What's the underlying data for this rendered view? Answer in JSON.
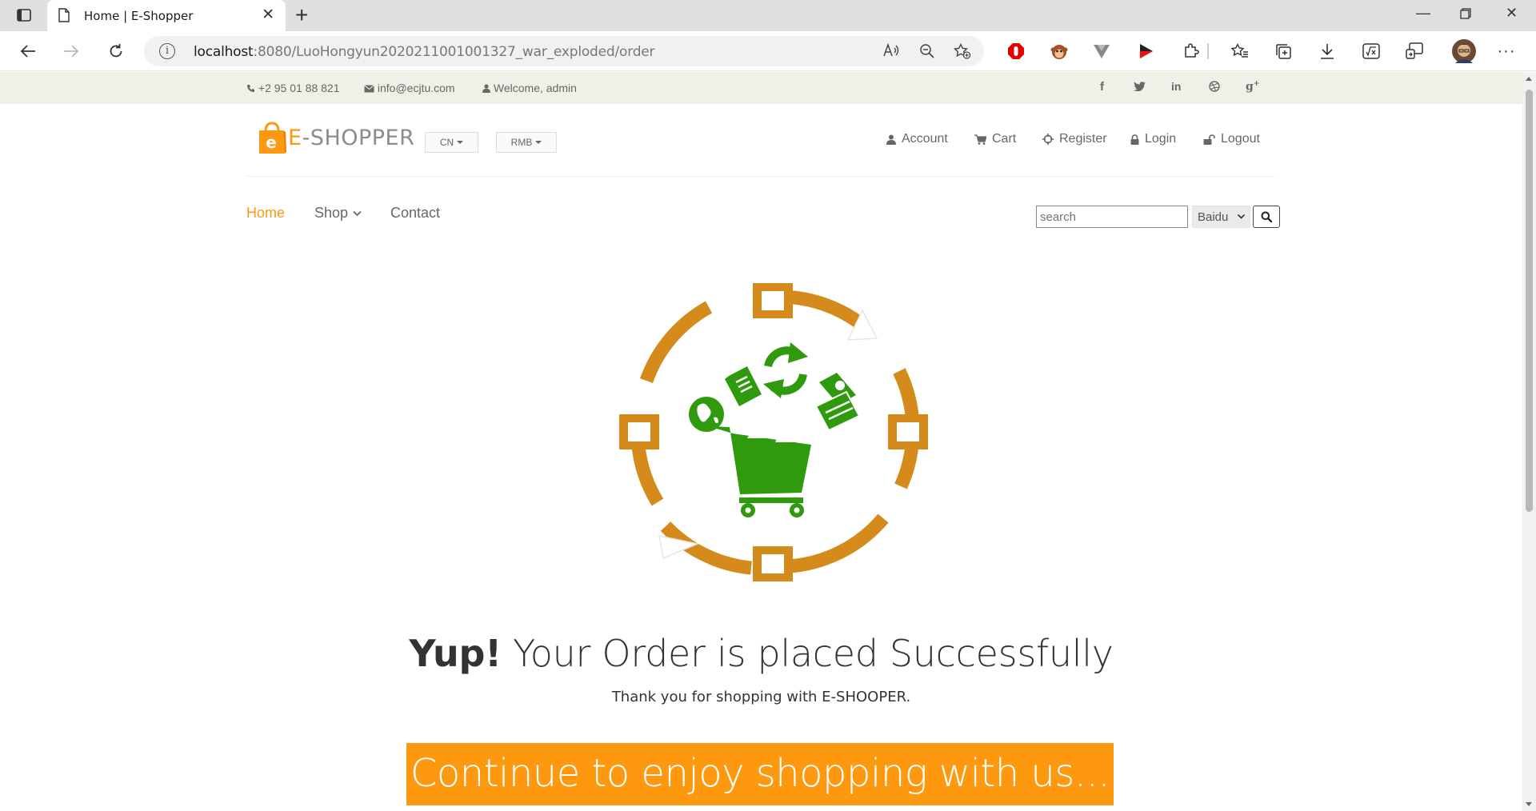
{
  "browser": {
    "tab_title": "Home | E-Shopper",
    "url_host": "localhost",
    "url_rest": ":8080/LuoHongyun2020211001001327_war_exploded/order"
  },
  "topbar": {
    "phone": "+2 95 01 88 821",
    "email": "info@ecjtu.com",
    "welcome": "Welcome, admin",
    "social": [
      "f",
      "t",
      "in",
      "dribbble",
      "g+"
    ]
  },
  "header": {
    "logo_e": "E",
    "logo_rest": "-SHOPPER",
    "language": "CN",
    "currency": "RMB",
    "links": {
      "account": "Account",
      "cart": "Cart",
      "register": "Register",
      "login": "Login",
      "logout": "Logout"
    }
  },
  "nav": {
    "home": "Home",
    "shop": "Shop",
    "contact": "Contact"
  },
  "search": {
    "placeholder": "search",
    "engine": "Baidu"
  },
  "main": {
    "headline_bold": "Yup!",
    "headline_rest": " Your Order is placed Successfully",
    "thanks": "Thank you for shopping with E-SHOOPER.",
    "continue": "Continue to enjoy shopping with us..."
  },
  "colors": {
    "accent": "#fe980f",
    "hero_ring": "#d58a1c",
    "hero_green": "#2f9a0e"
  }
}
